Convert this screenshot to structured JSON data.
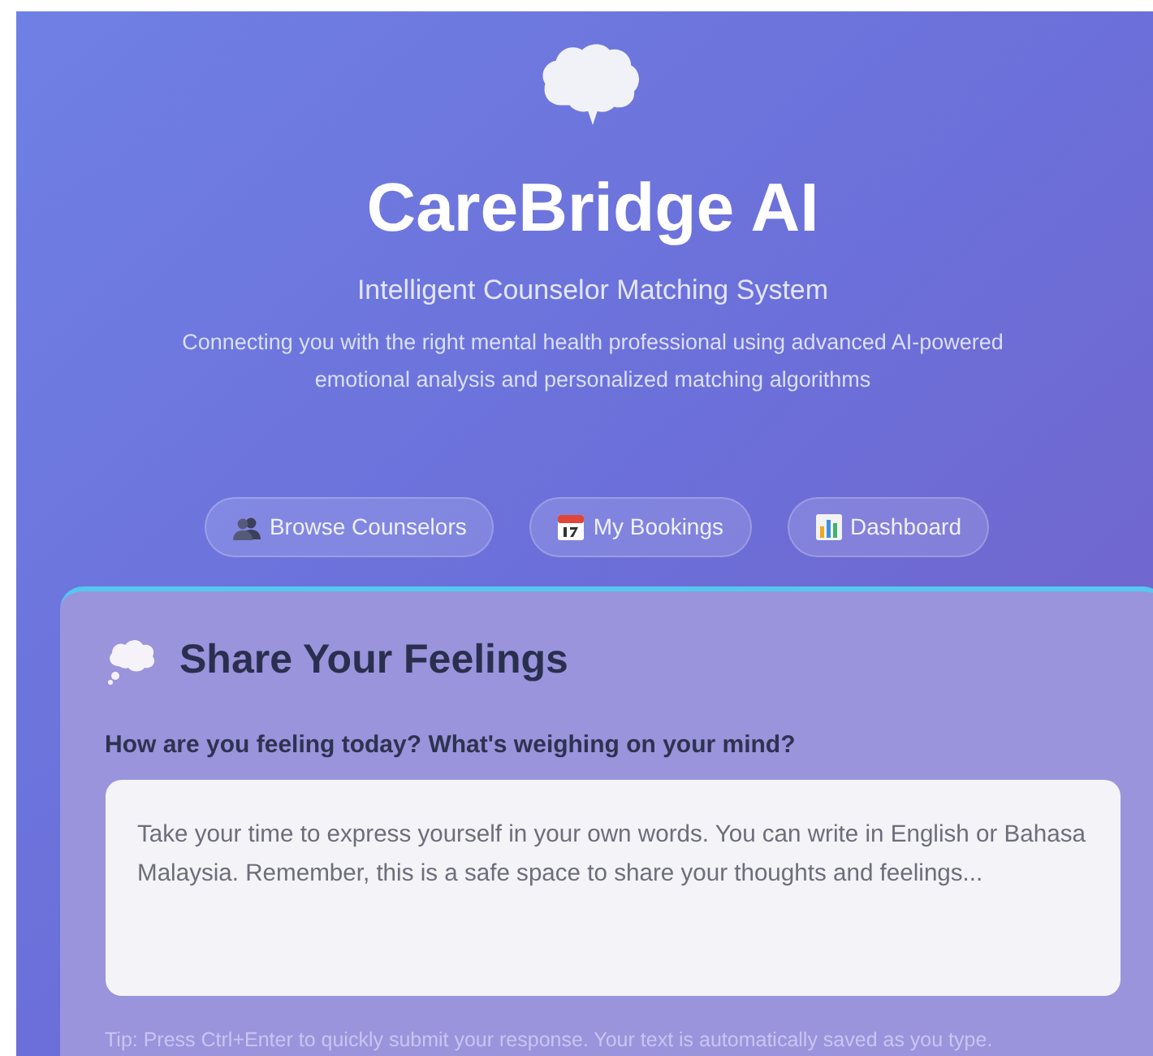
{
  "header": {
    "title": "CareBridge AI",
    "subtitle": "Intelligent Counselor Matching System",
    "description": "Connecting you with the right mental health professional using advanced AI-powered emotional analysis and personalized matching algorithms"
  },
  "nav": [
    {
      "kind": "people",
      "label": "Browse Counselors"
    },
    {
      "kind": "calendar",
      "label": "My Bookings"
    },
    {
      "kind": "chart",
      "label": "Dashboard"
    }
  ],
  "card": {
    "title": "Share Your Feelings",
    "question": "How are you feeling today? What's weighing on your mind?",
    "placeholder": "Take your time to express yourself in your own words. You can write in English or Bahasa Malaysia. Remember, this is a safe space to share your thoughts and feelings...",
    "tip": "Tip: Press Ctrl+Enter to quickly submit your response. Your text is automatically saved as you type."
  }
}
